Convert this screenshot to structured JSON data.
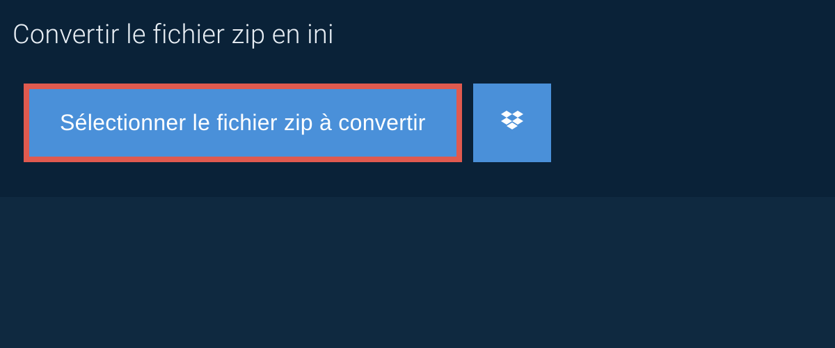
{
  "page": {
    "title": "Convertir le fichier zip en ini"
  },
  "actions": {
    "select_file_label": "Sélectionner le fichier zip à convertir"
  },
  "colors": {
    "background": "#0f2940",
    "panel": "#0a2238",
    "button_bg": "#4a90d9",
    "highlight_border": "#e05a4f",
    "text_light": "#e8eef4"
  }
}
